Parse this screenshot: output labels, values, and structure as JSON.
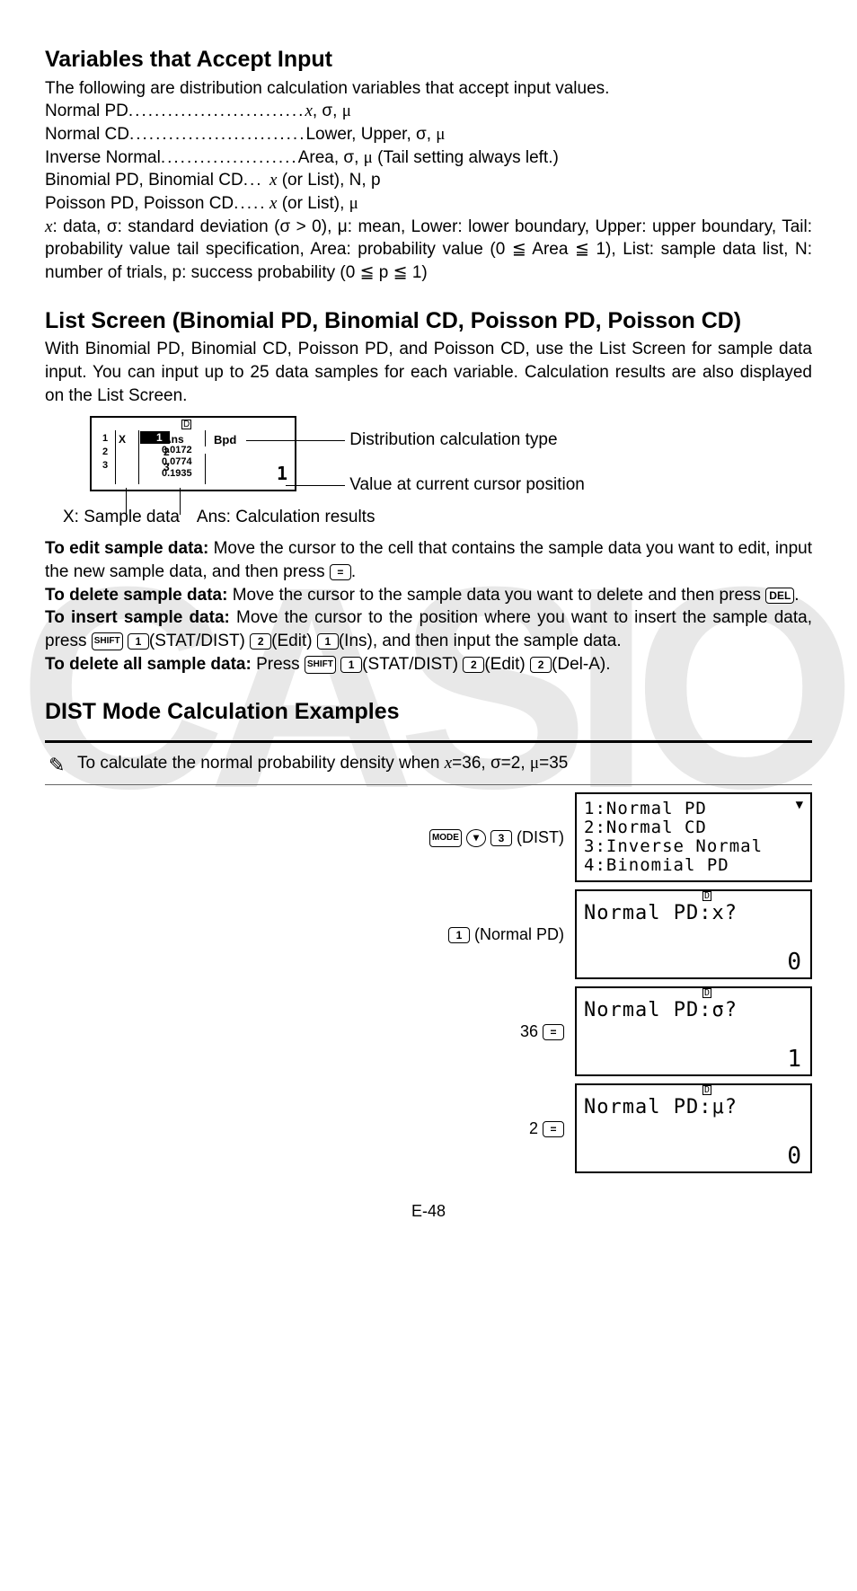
{
  "page": "E-48",
  "sec1": {
    "title": "Variables that Accept Input",
    "intro": "The following are distribution calculation variables that accept input values.",
    "rows": [
      {
        "label": "Normal PD",
        "vars": "x, σ, μ",
        "italicX": true
      },
      {
        "label": "Normal CD",
        "vars": "Lower, Upper, σ, μ"
      },
      {
        "label": "Inverse Normal",
        "vars": "Area, σ, μ (Tail setting always left.)"
      },
      {
        "label": "Binomial PD, Binomial CD",
        "vars": "x (or List), N, p",
        "italicX": true
      },
      {
        "label": "Poisson PD, Poisson CD",
        "vars": "x (or List), μ",
        "italicX": true
      }
    ],
    "footnote_x": "x",
    "footnote": ": data, σ: standard deviation (σ > 0), μ: mean, Lower: lower boundary, Upper: upper boundary, Tail: probability value tail specification, Area: probability value (0 ≦ Area ≦ 1), List: sample data list, N: number of trials, p: success probability (0 ≦ p ≦ 1)"
  },
  "sec2": {
    "title": "List Screen (Binomial PD, Binomial CD, Poisson PD, Poisson CD)",
    "intro": "With Binomial PD, Binomial CD, Poisson PD, and Poisson CD, use the List Screen for sample data input. You can input up to 25 data samples for each variable. Calculation results are also displayed on the List Screen.",
    "lcd": {
      "rows_idx": [
        "1",
        "2",
        "3"
      ],
      "ans": [
        "0.0172",
        "0.0774",
        "0.1935"
      ],
      "headX": "X",
      "headAns": "Ans",
      "bpd": "Bpd",
      "bigval": "1"
    },
    "callout1": "Distribution calculation type",
    "callout2": "Value at current cursor position",
    "caption": "X: Sample data Ans: Calculation results",
    "edit_b": "To edit sample data:",
    "edit_t": " Move the cursor to the cell that contains the sample data you want to edit, input the new sample data, and then press ",
    "del_b": "To delete sample data:",
    "del_t": " Move the cursor to the sample data you want to delete and then press ",
    "ins_b": "To insert sample data:",
    "ins_t1": " Move the cursor to the position where you want to insert the sample data, press ",
    "ins_t2": "(STAT/DIST)",
    "ins_t3": "(Edit)",
    "ins_t4": "(Ins), and then input the sample data.",
    "delall_b": "To delete all sample data:",
    "delall_t1": " Press ",
    "delall_t2": "(STAT/DIST)",
    "delall_t3": "(Edit)",
    "delall_t4": "(Del-A)."
  },
  "sec3": {
    "title": "DIST Mode Calculation Examples",
    "example_intro_a": "To calculate the normal probability density when ",
    "example_intro_b": "x",
    "example_intro_c": "=36, σ=2, ",
    "example_intro_d": "μ",
    "example_intro_e": "=35",
    "steps": [
      {
        "keys": "MODE ▾ 3",
        "suffix": "(DIST)",
        "lcd_type": "menu",
        "lcd_lines": "1:Normal PD\n2:Normal CD\n3:Inverse Normal\n4:Binomial PD"
      },
      {
        "keys": "1",
        "suffix": "(Normal PD)",
        "lcd_type": "prompt",
        "lcd_prompt": "Normal PD:x?",
        "lcd_val": "0"
      },
      {
        "keys": "36 =",
        "suffix": "",
        "lcd_type": "prompt",
        "lcd_prompt": "Normal PD:σ?",
        "lcd_val": "1"
      },
      {
        "keys": "2 =",
        "suffix": "",
        "lcd_type": "prompt",
        "lcd_prompt": "Normal PD:μ?",
        "lcd_val": "0"
      }
    ]
  },
  "keys": {
    "eq": "=",
    "del": "DEL",
    "shift": "SHIFT",
    "k1": "1",
    "k2": "2",
    "k3": "3",
    "mode": "MODE"
  }
}
